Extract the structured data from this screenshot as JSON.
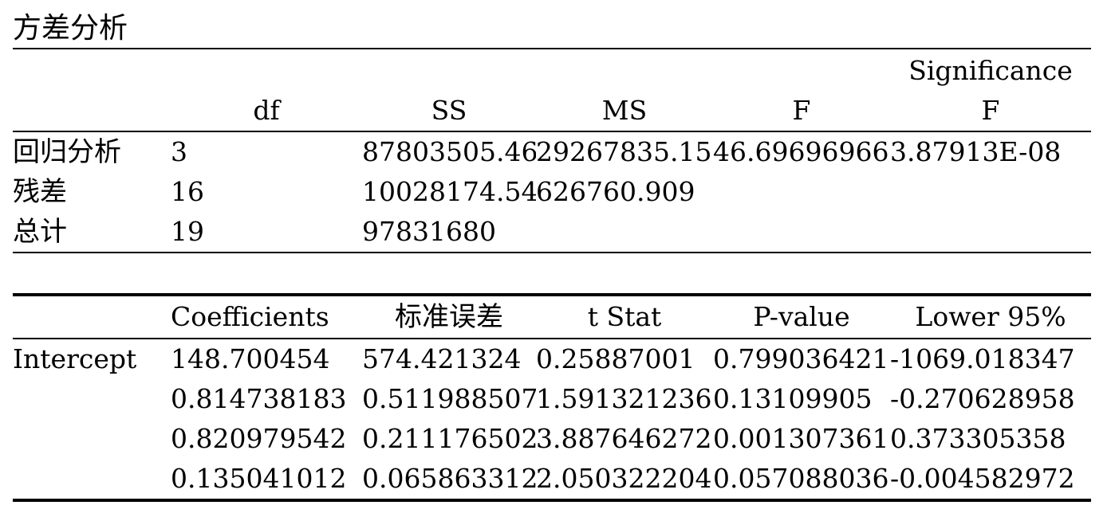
{
  "anova": {
    "title": "方差分析",
    "header_top": {
      "sig": "Significance"
    },
    "header": {
      "df": "df",
      "ss": "SS",
      "ms": "MS",
      "f": "F",
      "sig": "F"
    },
    "rows": [
      {
        "label": "回归分析",
        "df": "3",
        "ss": "87803505.46",
        "ms": "29267835.15",
        "f": "46.69696966",
        "sig": "3.87913E-08"
      },
      {
        "label": "残差",
        "df": "16",
        "ss": "10028174.54",
        "ms": "626760.909",
        "f": "",
        "sig": ""
      },
      {
        "label": "总计",
        "df": "19",
        "ss": "97831680",
        "ms": "",
        "f": "",
        "sig": ""
      }
    ]
  },
  "coefficients": {
    "header": {
      "label": "",
      "coef": "Coefficients",
      "se": "标准误差",
      "t": "t Stat",
      "p": "P-value",
      "lower": "Lower 95%"
    },
    "rows": [
      {
        "label": "Intercept",
        "coef": "148.700454",
        "se": "574.421324",
        "t": "0.25887001",
        "p": "0.799036421",
        "lower": "-1069.018347"
      },
      {
        "label": "",
        "coef": "0.814738183",
        "se": "0.511988507",
        "t": "1.591321236",
        "p": "0.13109905",
        "lower": "-0.270628958"
      },
      {
        "label": "",
        "coef": "0.820979542",
        "se": "0.211176502",
        "t": "3.887646272",
        "p": "0.001307361",
        "lower": "0.373305358"
      },
      {
        "label": "",
        "coef": "0.135041012",
        "se": "0.065863312",
        "t": "2.050322204",
        "p": "0.057088036",
        "lower": "-0.004582972"
      }
    ]
  }
}
